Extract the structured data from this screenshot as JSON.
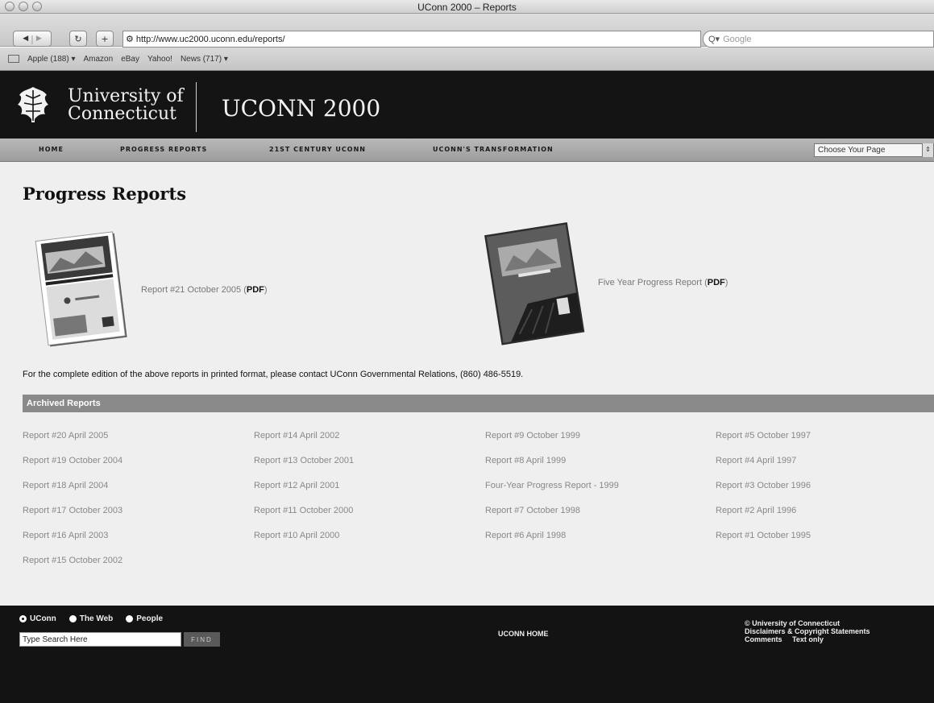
{
  "browser": {
    "window_title": "UConn 2000 – Reports",
    "url": "http://www.uc2000.uconn.edu/reports/",
    "search_placeholder": "Google",
    "bookmarks": [
      "Apple (188) ▾",
      "Amazon",
      "eBay",
      "Yahoo!",
      "News (717) ▾"
    ]
  },
  "header": {
    "university_line1": "University of",
    "university_line2": "Connecticut",
    "site_title": "UCONN 2000"
  },
  "nav": {
    "items": [
      "HOME",
      "PROGRESS REPORTS",
      "21ST CENTURY UCONN",
      "UCONN'S TRANSFORMATION"
    ],
    "page_select": "Choose Your Page"
  },
  "main": {
    "heading": "Progress Reports",
    "featured": [
      {
        "label": "Report #21 October 2005",
        "format": "PDF"
      },
      {
        "label": "Five Year Progress Report",
        "format": "PDF"
      }
    ],
    "contact_note": "For the complete edition of the above reports in printed format, please contact UConn Governmental Relations, (860) 486-5519.",
    "archived_title": "Archived Reports",
    "archive_columns": [
      [
        "Report #20 April 2005",
        "Report #19 October 2004",
        "Report #18 April 2004",
        "Report #17 October 2003",
        "Report #16 April 2003",
        "Report #15 October 2002"
      ],
      [
        "Report #14 April 2002",
        "Report #13 October 2001",
        "Report #12 April 2001",
        "Report #11 October 2000",
        "Report #10 April 2000"
      ],
      [
        "Report #9 October 1999",
        "Report #8 April 1999",
        "Four-Year Progress Report - 1999",
        "Report #7 October 1998",
        "Report #6 April 1998"
      ],
      [
        "Report #5 October 1997",
        "Report #4 April 1997",
        "Report #3 October 1996",
        "Report #2 April 1996",
        "Report #1 October 1995"
      ]
    ]
  },
  "footer": {
    "scopes": [
      "UConn",
      "The Web",
      "People"
    ],
    "search_placeholder": "Type Search Here",
    "find_label": "FIND",
    "home_link": "UCONN HOME",
    "copyright": "© University of Connecticut",
    "disclaimers": "Disclaimers & Copyright Statements",
    "comments": "Comments",
    "text_only": "Text only"
  }
}
